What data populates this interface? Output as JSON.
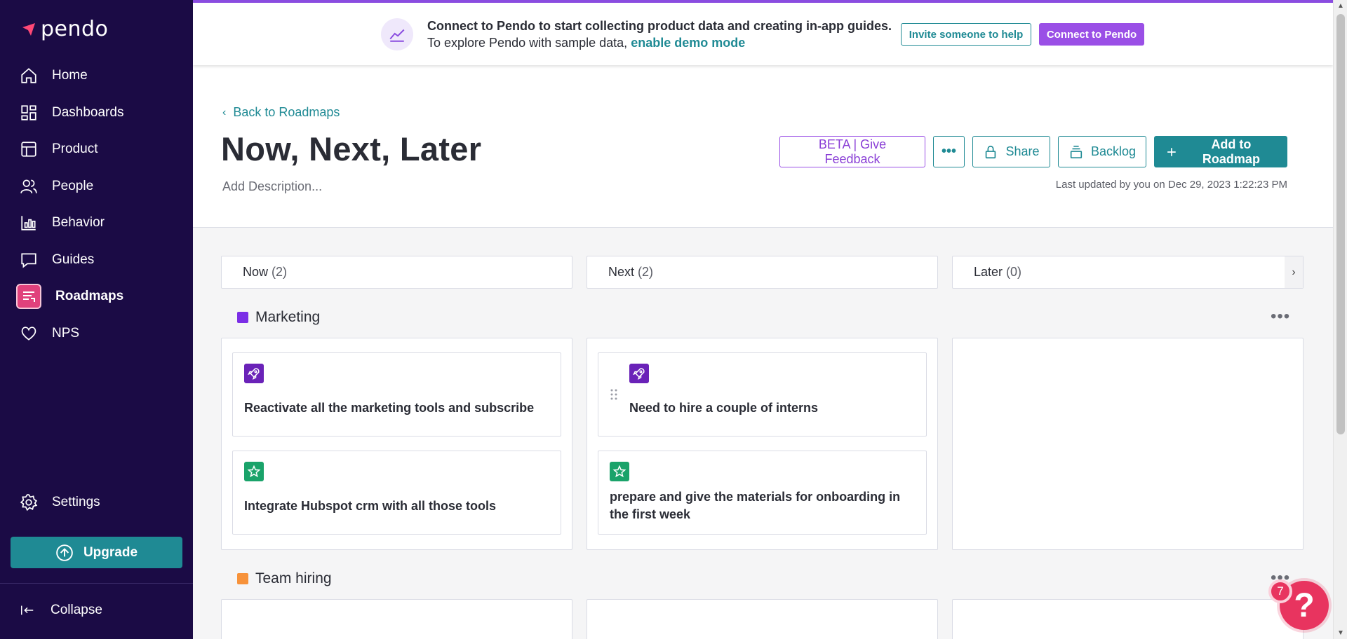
{
  "sidebar": {
    "logo_text": "pendo",
    "items": [
      {
        "label": "Home",
        "icon": "home-icon"
      },
      {
        "label": "Dashboards",
        "icon": "dashboards-icon"
      },
      {
        "label": "Product",
        "icon": "product-icon"
      },
      {
        "label": "People",
        "icon": "people-icon"
      },
      {
        "label": "Behavior",
        "icon": "behavior-icon"
      },
      {
        "label": "Guides",
        "icon": "guides-icon"
      },
      {
        "label": "Roadmaps",
        "icon": "roadmaps-icon",
        "active": true
      },
      {
        "label": "NPS",
        "icon": "heart-icon"
      }
    ],
    "settings_label": "Settings",
    "upgrade_label": "Upgrade",
    "collapse_label": "Collapse"
  },
  "banner": {
    "line1": "Connect to Pendo to start collecting product data and creating in-app guides.",
    "line2_prefix": "To explore Pendo with sample data,",
    "demo_link": "enable demo mode",
    "invite_label": "Invite someone to help",
    "connect_label": "Connect to Pendo"
  },
  "header": {
    "back_label": "Back to Roadmaps",
    "title": "Now, Next, Later",
    "description_placeholder": "Add Description...",
    "beta_label": "BETA | Give Feedback",
    "more_label": "•••",
    "share_label": "Share",
    "backlog_label": "Backlog",
    "add_label": "Add to Roadmap",
    "last_updated": "Last updated by you on Dec 29, 2023 1:22:23 PM"
  },
  "columns": [
    {
      "label": "Now",
      "count": "(2)"
    },
    {
      "label": "Next",
      "count": "(2)"
    },
    {
      "label": "Later",
      "count": "(0)"
    }
  ],
  "groups": [
    {
      "title": "Marketing",
      "color": "#7b2ee6",
      "cards": {
        "now": [
          {
            "text": "Reactivate all the marketing tools and subscribe",
            "badge": "rocket-icon",
            "badge_color": "#6a22b8"
          },
          {
            "text": "Integrate Hubspot crm with all those tools",
            "badge": "star-icon",
            "badge_color": "#1aa36a"
          }
        ],
        "next": [
          {
            "text": "Need to hire a couple of interns",
            "badge": "rocket-icon",
            "badge_color": "#6a22b8"
          },
          {
            "text": "prepare and give the materials for onboarding in the first week",
            "badge": "star-icon",
            "badge_color": "#1aa36a"
          }
        ]
      }
    },
    {
      "title": "Team hiring",
      "color": "#f7923a"
    }
  ],
  "help": {
    "badge_count": "7",
    "label": "?"
  },
  "colors": {
    "sidebar_bg": "#1b0b45",
    "teal": "#1f8a94",
    "purple": "#9a4fe6",
    "help_red": "#e8345f"
  }
}
